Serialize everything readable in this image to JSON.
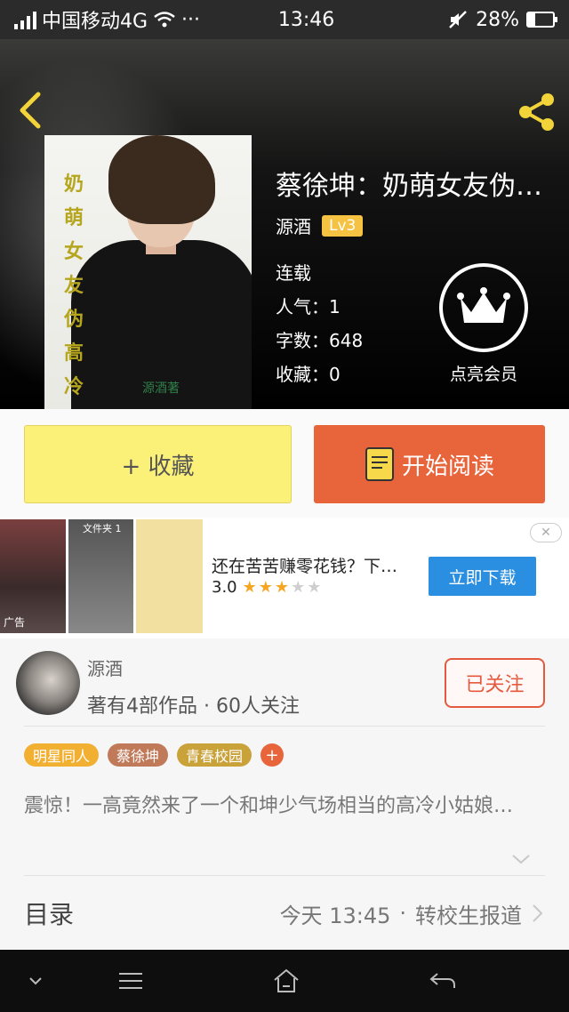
{
  "status_bar": {
    "carrier": "中国移动4G",
    "dots": "···",
    "time": "13:46",
    "battery": "28%",
    "battery_level": 0.28
  },
  "book": {
    "title": "蔡徐坤：奶萌女友伪…",
    "author": "源酒",
    "level": "Lv3",
    "status": "连载",
    "popularity": "人气：1",
    "words": "字数：648",
    "favorites": "收藏：0",
    "vip_label": "点亮会员",
    "cover_chars": [
      "奶",
      "萌",
      "女",
      "友",
      "伪",
      "高",
      "冷"
    ],
    "cover_signature": "源酒著"
  },
  "actions": {
    "favorite_label": "+ 收藏",
    "read_label": "开始阅读"
  },
  "ad": {
    "title": "还在苦苦赚零花钱？下…",
    "rating": "3.0",
    "stars_on": 3,
    "stars_total": 5,
    "download_label": "立即下载",
    "ad_tag": "广告",
    "folder_label": "文件夹 1"
  },
  "author": {
    "name": "源酒",
    "stats": "著有4部作品 · 60人关注",
    "follow_label": "已关注"
  },
  "tags": [
    {
      "label": "明星同人",
      "color": "#f2b033"
    },
    {
      "label": "蔡徐坤",
      "color": "#c07a5a"
    },
    {
      "label": "青春校园",
      "color": "#caa23a"
    }
  ],
  "tag_add": "+",
  "intro": "震惊！一高竟然来了一个和坤少气场相当的高冷小姑娘…",
  "toc": {
    "label": "目录",
    "time": "今天 13:45",
    "separator": "·",
    "latest_chapter": "转校生报道"
  },
  "colors": {
    "accent_orange": "#e8653c",
    "fav_yellow": "#fbf178",
    "level_gold": "#f5c242",
    "ad_blue": "#2a8fe0"
  },
  "icons": [
    "signal-icon",
    "wifi-icon",
    "mute-icon",
    "battery-icon",
    "back-icon",
    "share-icon",
    "crown-icon",
    "book-icon",
    "close-icon",
    "chevron-down-icon",
    "chevron-right-icon",
    "nav-down-icon",
    "nav-menu-icon",
    "nav-home-icon",
    "nav-back-icon"
  ]
}
